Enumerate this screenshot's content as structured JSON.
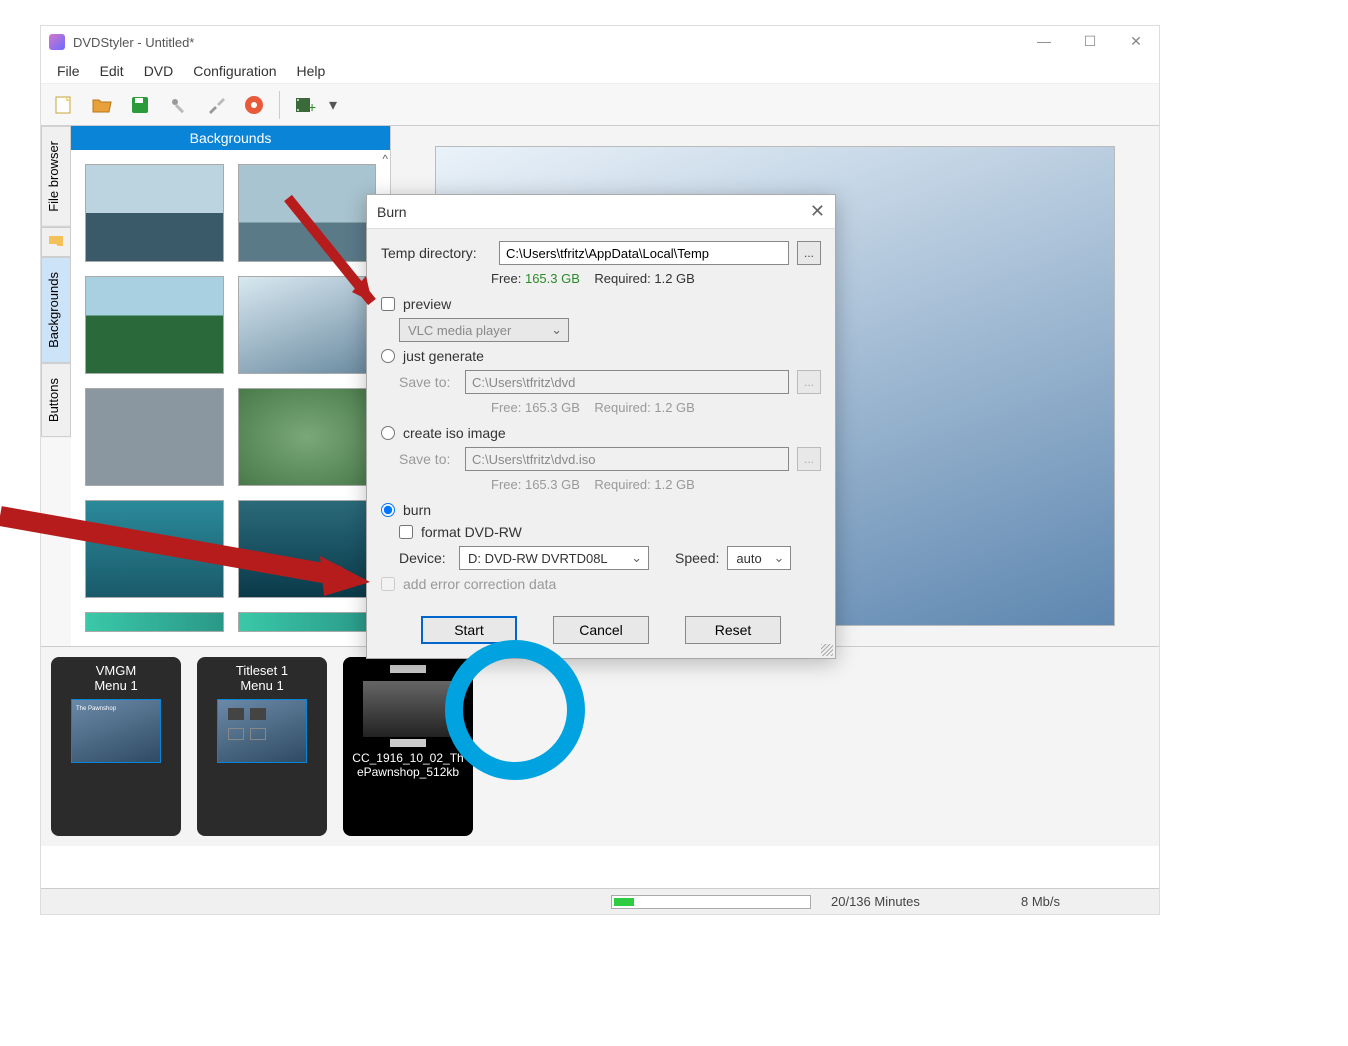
{
  "window": {
    "title": "DVDStyler - Untitled*"
  },
  "menubar": [
    "File",
    "Edit",
    "DVD",
    "Configuration",
    "Help"
  ],
  "sidebar_tabs": {
    "file_browser": "File browser",
    "backgrounds": "Backgrounds",
    "buttons": "Buttons"
  },
  "bg_panel": {
    "header": "Backgrounds"
  },
  "timeline": {
    "vmgm": {
      "title": "VMGM",
      "menu": "Menu 1"
    },
    "titleset": {
      "title": "Titleset 1",
      "menu": "Menu 1"
    },
    "video": {
      "name": "CC_1916_10_02_ThePawnshop_512kb"
    }
  },
  "status": {
    "minutes": "20/136 Minutes",
    "rate": "8 Mb/s"
  },
  "dialog": {
    "title": "Burn",
    "temp_label": "Temp directory:",
    "temp_value": "C:\\Users\\tfritz\\AppData\\Local\\Temp",
    "browse": "...",
    "free_label": "Free:",
    "free_value": "165.3 GB",
    "required_label": "Required:",
    "required_value": "1.2 GB",
    "preview_label": "preview",
    "preview_player": "VLC media player",
    "just_generate_label": "just generate",
    "saveto_label": "Save to:",
    "saveto_dvd": "C:\\Users\\tfritz\\dvd",
    "free2_value": "165.3 GB",
    "required2_value": "1.2 GB",
    "create_iso_label": "create iso image",
    "saveto_iso": "C:\\Users\\tfritz\\dvd.iso",
    "free3_value": "165.3 GB",
    "required3_value": "1.2 GB",
    "burn_label": "burn",
    "format_label": "format DVD-RW",
    "device_label": "Device:",
    "device_value": "D: DVD-RW  DVRTD08L",
    "speed_label": "Speed:",
    "speed_value": "auto",
    "ecc_label": "add error correction data",
    "start": "Start",
    "cancel": "Cancel",
    "reset": "Reset"
  }
}
